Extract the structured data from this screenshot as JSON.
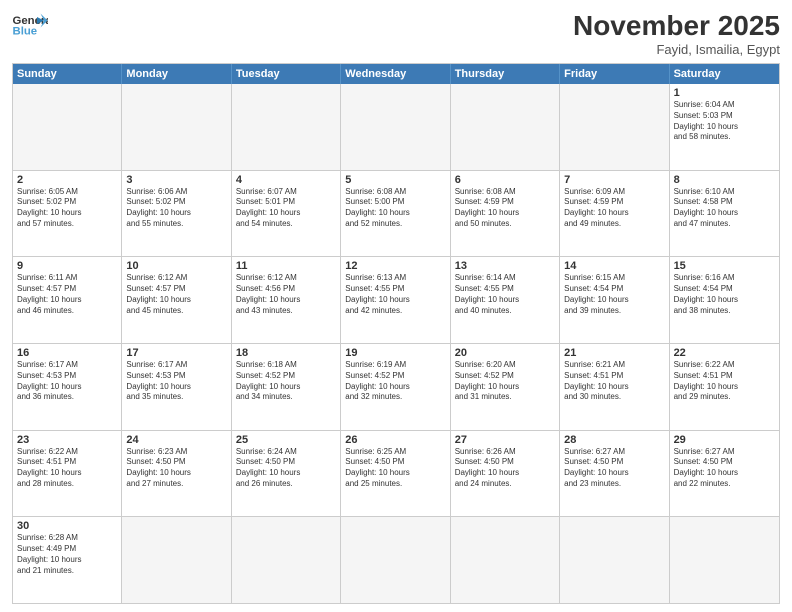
{
  "header": {
    "logo_general": "General",
    "logo_blue": "Blue",
    "month_title": "November 2025",
    "location": "Fayid, Ismailia, Egypt"
  },
  "weekdays": [
    "Sunday",
    "Monday",
    "Tuesday",
    "Wednesday",
    "Thursday",
    "Friday",
    "Saturday"
  ],
  "rows": [
    [
      {
        "day": "",
        "info": "",
        "empty": true
      },
      {
        "day": "",
        "info": "",
        "empty": true
      },
      {
        "day": "",
        "info": "",
        "empty": true
      },
      {
        "day": "",
        "info": "",
        "empty": true
      },
      {
        "day": "",
        "info": "",
        "empty": true
      },
      {
        "day": "",
        "info": "",
        "empty": true
      },
      {
        "day": "1",
        "info": "Sunrise: 6:04 AM\nSunset: 5:03 PM\nDaylight: 10 hours\nand 58 minutes.",
        "empty": false
      }
    ],
    [
      {
        "day": "2",
        "info": "Sunrise: 6:05 AM\nSunset: 5:02 PM\nDaylight: 10 hours\nand 57 minutes.",
        "empty": false
      },
      {
        "day": "3",
        "info": "Sunrise: 6:06 AM\nSunset: 5:02 PM\nDaylight: 10 hours\nand 55 minutes.",
        "empty": false
      },
      {
        "day": "4",
        "info": "Sunrise: 6:07 AM\nSunset: 5:01 PM\nDaylight: 10 hours\nand 54 minutes.",
        "empty": false
      },
      {
        "day": "5",
        "info": "Sunrise: 6:08 AM\nSunset: 5:00 PM\nDaylight: 10 hours\nand 52 minutes.",
        "empty": false
      },
      {
        "day": "6",
        "info": "Sunrise: 6:08 AM\nSunset: 4:59 PM\nDaylight: 10 hours\nand 50 minutes.",
        "empty": false
      },
      {
        "day": "7",
        "info": "Sunrise: 6:09 AM\nSunset: 4:59 PM\nDaylight: 10 hours\nand 49 minutes.",
        "empty": false
      },
      {
        "day": "8",
        "info": "Sunrise: 6:10 AM\nSunset: 4:58 PM\nDaylight: 10 hours\nand 47 minutes.",
        "empty": false
      }
    ],
    [
      {
        "day": "9",
        "info": "Sunrise: 6:11 AM\nSunset: 4:57 PM\nDaylight: 10 hours\nand 46 minutes.",
        "empty": false
      },
      {
        "day": "10",
        "info": "Sunrise: 6:12 AM\nSunset: 4:57 PM\nDaylight: 10 hours\nand 45 minutes.",
        "empty": false
      },
      {
        "day": "11",
        "info": "Sunrise: 6:12 AM\nSunset: 4:56 PM\nDaylight: 10 hours\nand 43 minutes.",
        "empty": false
      },
      {
        "day": "12",
        "info": "Sunrise: 6:13 AM\nSunset: 4:55 PM\nDaylight: 10 hours\nand 42 minutes.",
        "empty": false
      },
      {
        "day": "13",
        "info": "Sunrise: 6:14 AM\nSunset: 4:55 PM\nDaylight: 10 hours\nand 40 minutes.",
        "empty": false
      },
      {
        "day": "14",
        "info": "Sunrise: 6:15 AM\nSunset: 4:54 PM\nDaylight: 10 hours\nand 39 minutes.",
        "empty": false
      },
      {
        "day": "15",
        "info": "Sunrise: 6:16 AM\nSunset: 4:54 PM\nDaylight: 10 hours\nand 38 minutes.",
        "empty": false
      }
    ],
    [
      {
        "day": "16",
        "info": "Sunrise: 6:17 AM\nSunset: 4:53 PM\nDaylight: 10 hours\nand 36 minutes.",
        "empty": false
      },
      {
        "day": "17",
        "info": "Sunrise: 6:17 AM\nSunset: 4:53 PM\nDaylight: 10 hours\nand 35 minutes.",
        "empty": false
      },
      {
        "day": "18",
        "info": "Sunrise: 6:18 AM\nSunset: 4:52 PM\nDaylight: 10 hours\nand 34 minutes.",
        "empty": false
      },
      {
        "day": "19",
        "info": "Sunrise: 6:19 AM\nSunset: 4:52 PM\nDaylight: 10 hours\nand 32 minutes.",
        "empty": false
      },
      {
        "day": "20",
        "info": "Sunrise: 6:20 AM\nSunset: 4:52 PM\nDaylight: 10 hours\nand 31 minutes.",
        "empty": false
      },
      {
        "day": "21",
        "info": "Sunrise: 6:21 AM\nSunset: 4:51 PM\nDaylight: 10 hours\nand 30 minutes.",
        "empty": false
      },
      {
        "day": "22",
        "info": "Sunrise: 6:22 AM\nSunset: 4:51 PM\nDaylight: 10 hours\nand 29 minutes.",
        "empty": false
      }
    ],
    [
      {
        "day": "23",
        "info": "Sunrise: 6:22 AM\nSunset: 4:51 PM\nDaylight: 10 hours\nand 28 minutes.",
        "empty": false
      },
      {
        "day": "24",
        "info": "Sunrise: 6:23 AM\nSunset: 4:50 PM\nDaylight: 10 hours\nand 27 minutes.",
        "empty": false
      },
      {
        "day": "25",
        "info": "Sunrise: 6:24 AM\nSunset: 4:50 PM\nDaylight: 10 hours\nand 26 minutes.",
        "empty": false
      },
      {
        "day": "26",
        "info": "Sunrise: 6:25 AM\nSunset: 4:50 PM\nDaylight: 10 hours\nand 25 minutes.",
        "empty": false
      },
      {
        "day": "27",
        "info": "Sunrise: 6:26 AM\nSunset: 4:50 PM\nDaylight: 10 hours\nand 24 minutes.",
        "empty": false
      },
      {
        "day": "28",
        "info": "Sunrise: 6:27 AM\nSunset: 4:50 PM\nDaylight: 10 hours\nand 23 minutes.",
        "empty": false
      },
      {
        "day": "29",
        "info": "Sunrise: 6:27 AM\nSunset: 4:50 PM\nDaylight: 10 hours\nand 22 minutes.",
        "empty": false
      }
    ],
    [
      {
        "day": "30",
        "info": "Sunrise: 6:28 AM\nSunset: 4:49 PM\nDaylight: 10 hours\nand 21 minutes.",
        "empty": false
      },
      {
        "day": "",
        "info": "",
        "empty": true
      },
      {
        "day": "",
        "info": "",
        "empty": true
      },
      {
        "day": "",
        "info": "",
        "empty": true
      },
      {
        "day": "",
        "info": "",
        "empty": true
      },
      {
        "day": "",
        "info": "",
        "empty": true
      },
      {
        "day": "",
        "info": "",
        "empty": true
      }
    ]
  ]
}
